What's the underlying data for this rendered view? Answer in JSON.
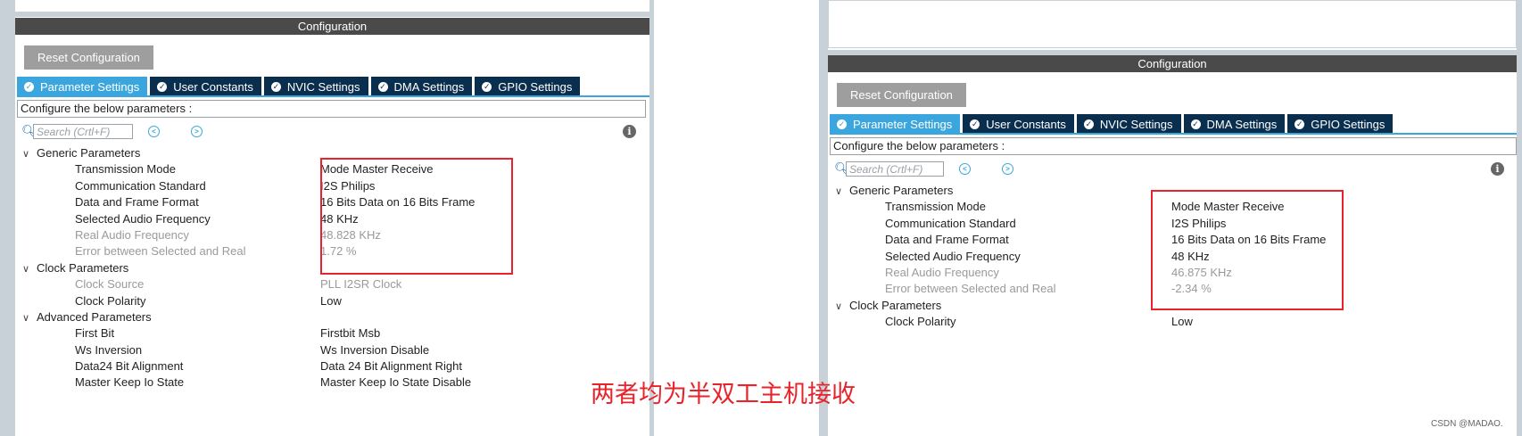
{
  "left_panel": {
    "header": "Configuration",
    "reset_button": "Reset Configuration",
    "tabs": [
      {
        "label": "Parameter Settings",
        "active": true
      },
      {
        "label": "User Constants",
        "active": false
      },
      {
        "label": "NVIC Settings",
        "active": false
      },
      {
        "label": "DMA Settings",
        "active": false
      },
      {
        "label": "GPIO Settings",
        "active": false
      }
    ],
    "configure_label": "Configure the below parameters :",
    "search_placeholder": "Search (Crtl+F)",
    "groups": [
      {
        "name": "Generic Parameters",
        "params": [
          {
            "name": "Transmission Mode",
            "value": "Mode Master Receive",
            "disabled": false
          },
          {
            "name": "Communication Standard",
            "value": "I2S Philips",
            "disabled": false
          },
          {
            "name": "Data and Frame Format",
            "value": "16 Bits Data on 16 Bits Frame",
            "disabled": false
          },
          {
            "name": "Selected Audio Frequency",
            "value": "48 KHz",
            "disabled": false
          },
          {
            "name": "Real Audio Frequency",
            "value": "48.828 KHz",
            "disabled": true
          },
          {
            "name": "Error between Selected and Real",
            "value": "1.72 %",
            "disabled": true
          }
        ]
      },
      {
        "name": "Clock Parameters",
        "params": [
          {
            "name": "Clock Source",
            "value": "PLL I2SR Clock",
            "disabled": true
          },
          {
            "name": "Clock Polarity",
            "value": "Low",
            "disabled": false
          }
        ]
      },
      {
        "name": "Advanced Parameters",
        "params": [
          {
            "name": "First Bit",
            "value": "Firstbit Msb",
            "disabled": false
          },
          {
            "name": "Ws Inversion",
            "value": "Ws Inversion Disable",
            "disabled": false
          },
          {
            "name": "Data24 Bit Alignment",
            "value": "Data 24 Bit Alignment Right",
            "disabled": false
          },
          {
            "name": "Master Keep Io State",
            "value": "Master Keep Io State Disable",
            "disabled": false
          }
        ]
      }
    ]
  },
  "right_panel": {
    "header": "Configuration",
    "reset_button": "Reset Configuration",
    "tabs": [
      {
        "label": "Parameter Settings",
        "active": true
      },
      {
        "label": "User Constants",
        "active": false
      },
      {
        "label": "NVIC Settings",
        "active": false
      },
      {
        "label": "DMA Settings",
        "active": false
      },
      {
        "label": "GPIO Settings",
        "active": false
      }
    ],
    "configure_label": "Configure the below parameters :",
    "search_placeholder": "Search (Crtl+F)",
    "groups": [
      {
        "name": "Generic Parameters",
        "params": [
          {
            "name": "Transmission Mode",
            "value": "Mode Master Receive",
            "disabled": false
          },
          {
            "name": "Communication Standard",
            "value": "I2S Philips",
            "disabled": false
          },
          {
            "name": "Data and Frame Format",
            "value": "16 Bits Data on 16 Bits Frame",
            "disabled": false
          },
          {
            "name": "Selected Audio Frequency",
            "value": "48 KHz",
            "disabled": false
          },
          {
            "name": "Real Audio Frequency",
            "value": "46.875 KHz",
            "disabled": true
          },
          {
            "name": "Error between Selected and Real",
            "value": "-2.34 %",
            "disabled": true
          }
        ]
      },
      {
        "name": "Clock Parameters",
        "params": [
          {
            "name": "Clock Polarity",
            "value": "Low",
            "disabled": false
          }
        ]
      }
    ]
  },
  "caption": "两者均为半双工主机接收",
  "watermark": "CSDN @MADAO.",
  "colors": {
    "tab_active": "#3aa6dd",
    "tab_inactive": "#0a2f4e",
    "header_bg": "#4a4a4a",
    "highlight": "#e8232b",
    "disabled_text": "#9a9a9a"
  },
  "icons": {
    "check": "check-circle-icon",
    "search": "search-icon",
    "prev": "chevron-left-circle-icon",
    "next": "chevron-right-circle-icon",
    "info": "info-icon",
    "expand": "chevron-down-icon"
  }
}
